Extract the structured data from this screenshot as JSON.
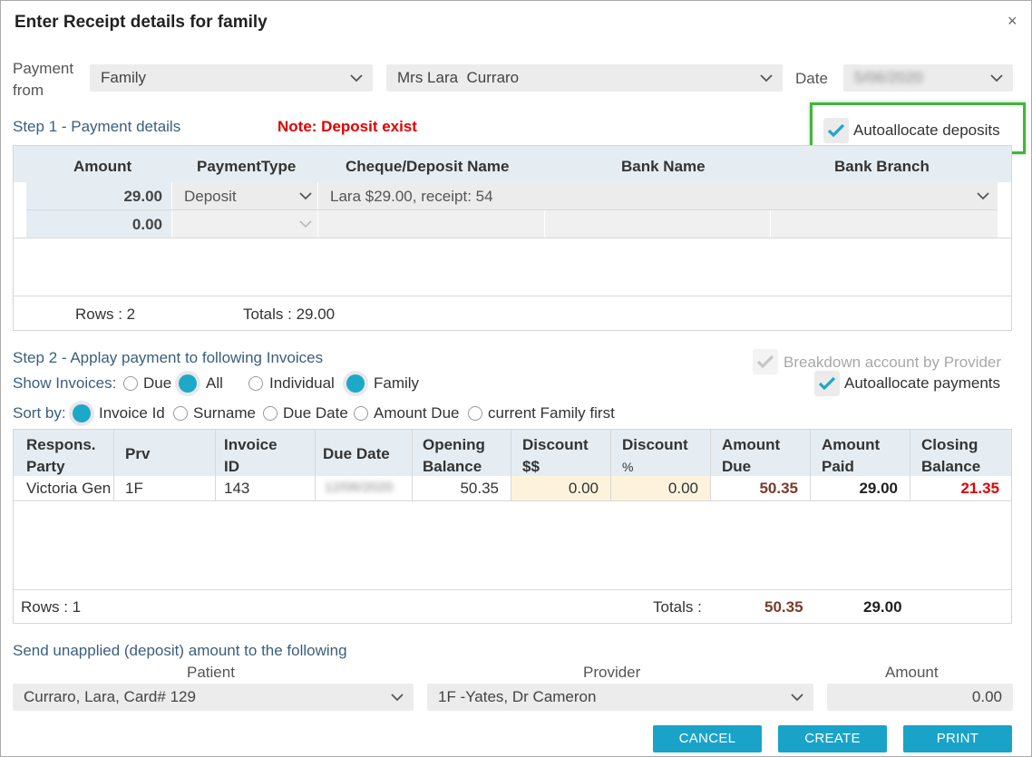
{
  "dialog": {
    "title": "Enter Receipt details for family",
    "close": "×"
  },
  "payment": {
    "from_label_1": "Payment",
    "from_label_2": "from",
    "from_value": "Family",
    "person_value": "Mrs Lara  Curraro",
    "date_label": "Date",
    "date_value": "5/06/2020"
  },
  "step1": {
    "title": "Step 1 - Payment details",
    "note": "Note: Deposit exist",
    "autoallocate_deposits": "Autoallocate deposits",
    "columns": [
      "Amount",
      "PaymentType",
      "Cheque/Deposit Name",
      "Bank Name",
      "Bank Branch"
    ],
    "rows": [
      {
        "amount": "29.00",
        "type": "Deposit",
        "name": "Lara $29.00, receipt: 54"
      },
      {
        "amount": "0.00",
        "type": "",
        "name": ""
      }
    ],
    "rows_label": "Rows : 2",
    "totals_label": "Totals : 29.00"
  },
  "step2": {
    "title": "Step 2 - Applay payment to following Invoices",
    "breakdown": "Breakdown account by Provider",
    "autoallocate_payments": "Autoallocate payments",
    "show_label": "Show Invoices:",
    "show_options": [
      "Due",
      "All",
      "Individual",
      "Family"
    ],
    "sort_label": "Sort by:",
    "sort_options": [
      "Invoice Id",
      "Surname",
      "Due Date",
      "Amount Due",
      "current Family first"
    ],
    "columns": [
      [
        "Respons.",
        "Party"
      ],
      [
        "Prv",
        ""
      ],
      [
        "Invoice",
        "ID"
      ],
      [
        "Due Date",
        ""
      ],
      [
        "Opening",
        "Balance"
      ],
      [
        "Discount",
        "$$"
      ],
      [
        "Discount",
        "%"
      ],
      [
        "Amount",
        "Due"
      ],
      [
        "Amount",
        "Paid"
      ],
      [
        "Closing",
        "Balance"
      ]
    ],
    "row": {
      "party": "Victoria Gen",
      "prv": "1F",
      "invoice": "143",
      "due_date": "12/06/2020",
      "opening": "50.35",
      "disc_amt": "0.00",
      "disc_pct": "0.00",
      "amount_due": "50.35",
      "amount_paid": "29.00",
      "closing": "21.35"
    },
    "rows_label": "Rows : 1",
    "totals_label": "Totals :",
    "total_due": "50.35",
    "total_paid": "29.00"
  },
  "unapplied": {
    "title": "Send unapplied (deposit) amount to the following",
    "patient_label": "Patient",
    "patient_value": "Curraro, Lara, Card# 129",
    "provider_label": "Provider",
    "provider_value": "1F -Yates, Dr Cameron",
    "amount_label": "Amount",
    "amount_value": "0.00"
  },
  "buttons": {
    "cancel": "CANCEL",
    "create": "CREATE",
    "print": "PRINT"
  },
  "colors": {
    "accent": "#1aa3c9",
    "note": "#e00000",
    "highlight": "#3db836",
    "due": "#7b3b2a",
    "closing": "#e00000"
  }
}
